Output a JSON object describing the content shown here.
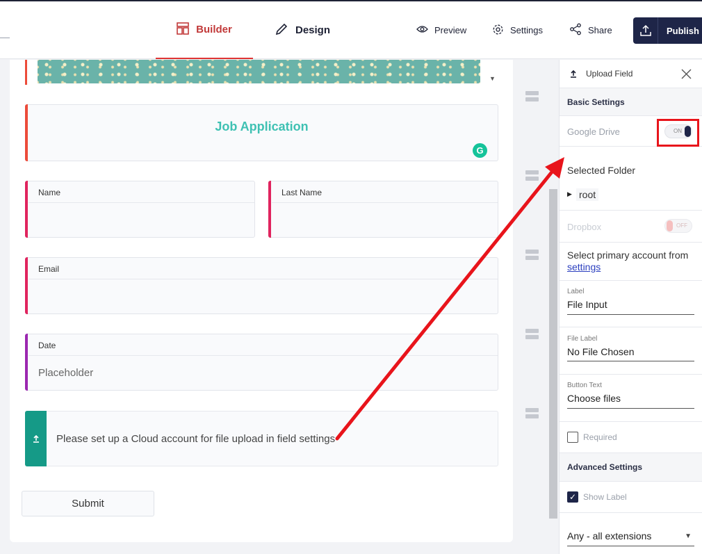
{
  "header": {
    "tabs": [
      {
        "label": "Builder",
        "icon": "builder-icon",
        "active": true
      },
      {
        "label": "Design",
        "icon": "pen-icon",
        "active": false
      }
    ],
    "actions": {
      "preview": "Preview",
      "settings": "Settings",
      "share": "Share",
      "publish": "Publish"
    }
  },
  "form": {
    "title": "Job Application",
    "fields": {
      "name_label": "Name",
      "last_name_label": "Last Name",
      "email_label": "Email",
      "date_label": "Date",
      "date_placeholder": "Placeholder"
    },
    "upload_message": "Please set up a Cloud account for file upload in field settings",
    "submit_label": "Submit",
    "grammarly_badge": "G"
  },
  "panel": {
    "title": "Upload Field",
    "basic_settings": "Basic Settings",
    "google_drive": {
      "label": "Google Drive",
      "state": "ON",
      "enabled": true
    },
    "selected_folder": {
      "label": "Selected Folder",
      "folder": "root"
    },
    "dropbox": {
      "label": "Dropbox",
      "state": "OFF",
      "enabled": false
    },
    "account_note": "Select primary account from",
    "account_link": "settings",
    "label_caption": "Label",
    "label_value": "File Input",
    "file_label_caption": "File Label",
    "file_label_value": "No File Chosen",
    "button_text_caption": "Button Text",
    "button_text_value": "Choose files",
    "required": {
      "label": "Required",
      "checked": false
    },
    "advanced_settings": "Advanced Settings",
    "show_label": {
      "label": "Show Label",
      "checked": true
    },
    "extensions": "Any - all extensions"
  },
  "colors": {
    "accent_red": "#e8141b",
    "brand_navy": "#1e2548",
    "teal": "#159a87",
    "title_teal": "#3fc1b3"
  }
}
